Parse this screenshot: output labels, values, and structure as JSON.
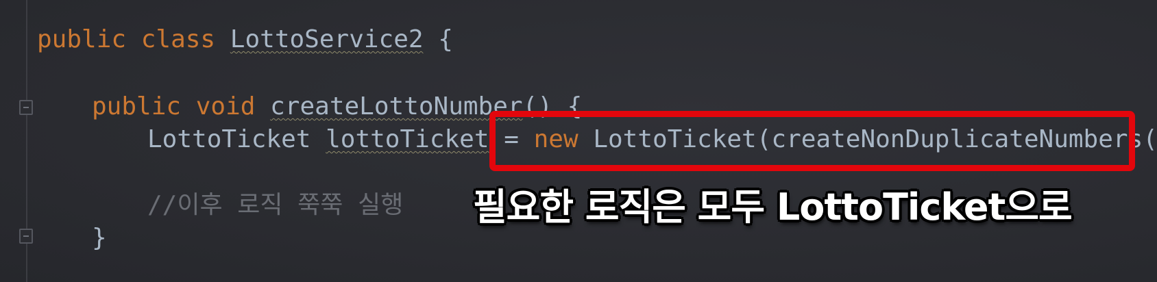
{
  "code": {
    "line1": {
      "kw1": "public",
      "kw2": "class",
      "class_name": "LottoService2",
      "brace": "{"
    },
    "line2": {
      "kw1": "public",
      "kw2": "void",
      "method_name": "createLottoNumber",
      "rest": "() {"
    },
    "line3": {
      "type": "LottoTicket",
      "var_name": "lottoTicket",
      "assign": "=",
      "kw_new": "new",
      "expr": "LottoTicket(createNonDuplicateNumbers())",
      "semicolon": ";"
    },
    "line4": {
      "comment": "//이후 로직 쭉쭉 실행"
    },
    "line5": {
      "brace": "}"
    }
  },
  "caption": "필요한 로직은 모두 LottoTicket으로",
  "colors": {
    "background": "#2b2c31",
    "keyword": "#cc7832",
    "text": "#a9b7c6",
    "comment": "#6a6d74",
    "highlight_border": "#e3060c",
    "caption": "#ffffff"
  }
}
